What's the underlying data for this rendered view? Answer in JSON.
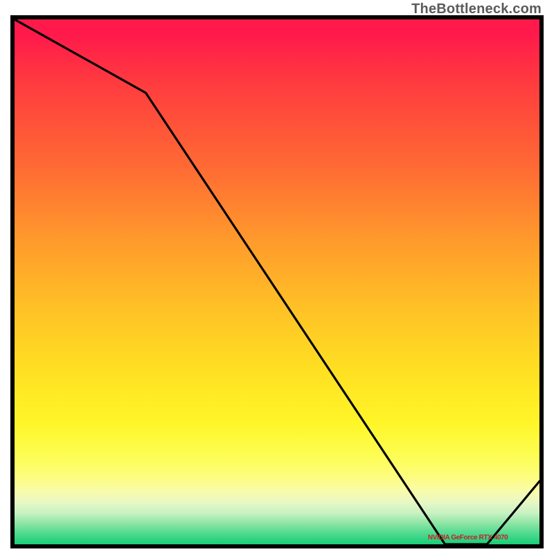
{
  "watermark": "TheBottleneck.com",
  "x_label": "NVIDIA GeForce RTX 4070",
  "chart_data": {
    "type": "line",
    "title": "",
    "xlabel": "",
    "ylabel": "",
    "x": [
      0.0,
      0.25,
      0.82,
      0.9,
      1.0
    ],
    "values": [
      1.0,
      0.86,
      0.0,
      0.0,
      0.12
    ],
    "xlim": [
      0,
      1
    ],
    "ylim": [
      0,
      1
    ],
    "series_color": "#000000",
    "x_annotation": {
      "text": "NVIDIA GeForce RTX 4070",
      "position": 0.86
    },
    "gradient_colormap": "green-yellow-red (bottom to top)"
  }
}
